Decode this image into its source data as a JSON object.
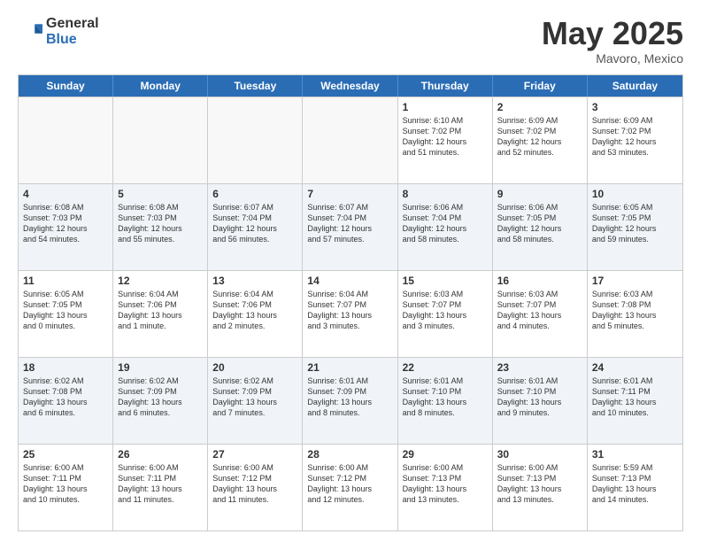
{
  "logo": {
    "general": "General",
    "blue": "Blue"
  },
  "header": {
    "month": "May 2025",
    "location": "Mavoro, Mexico"
  },
  "weekdays": [
    "Sunday",
    "Monday",
    "Tuesday",
    "Wednesday",
    "Thursday",
    "Friday",
    "Saturday"
  ],
  "rows": [
    [
      {
        "day": "",
        "text": "",
        "empty": true
      },
      {
        "day": "",
        "text": "",
        "empty": true
      },
      {
        "day": "",
        "text": "",
        "empty": true
      },
      {
        "day": "",
        "text": "",
        "empty": true
      },
      {
        "day": "1",
        "text": "Sunrise: 6:10 AM\nSunset: 7:02 PM\nDaylight: 12 hours\nand 51 minutes."
      },
      {
        "day": "2",
        "text": "Sunrise: 6:09 AM\nSunset: 7:02 PM\nDaylight: 12 hours\nand 52 minutes."
      },
      {
        "day": "3",
        "text": "Sunrise: 6:09 AM\nSunset: 7:02 PM\nDaylight: 12 hours\nand 53 minutes."
      }
    ],
    [
      {
        "day": "4",
        "text": "Sunrise: 6:08 AM\nSunset: 7:03 PM\nDaylight: 12 hours\nand 54 minutes."
      },
      {
        "day": "5",
        "text": "Sunrise: 6:08 AM\nSunset: 7:03 PM\nDaylight: 12 hours\nand 55 minutes."
      },
      {
        "day": "6",
        "text": "Sunrise: 6:07 AM\nSunset: 7:04 PM\nDaylight: 12 hours\nand 56 minutes."
      },
      {
        "day": "7",
        "text": "Sunrise: 6:07 AM\nSunset: 7:04 PM\nDaylight: 12 hours\nand 57 minutes."
      },
      {
        "day": "8",
        "text": "Sunrise: 6:06 AM\nSunset: 7:04 PM\nDaylight: 12 hours\nand 58 minutes."
      },
      {
        "day": "9",
        "text": "Sunrise: 6:06 AM\nSunset: 7:05 PM\nDaylight: 12 hours\nand 58 minutes."
      },
      {
        "day": "10",
        "text": "Sunrise: 6:05 AM\nSunset: 7:05 PM\nDaylight: 12 hours\nand 59 minutes."
      }
    ],
    [
      {
        "day": "11",
        "text": "Sunrise: 6:05 AM\nSunset: 7:05 PM\nDaylight: 13 hours\nand 0 minutes."
      },
      {
        "day": "12",
        "text": "Sunrise: 6:04 AM\nSunset: 7:06 PM\nDaylight: 13 hours\nand 1 minute."
      },
      {
        "day": "13",
        "text": "Sunrise: 6:04 AM\nSunset: 7:06 PM\nDaylight: 13 hours\nand 2 minutes."
      },
      {
        "day": "14",
        "text": "Sunrise: 6:04 AM\nSunset: 7:07 PM\nDaylight: 13 hours\nand 3 minutes."
      },
      {
        "day": "15",
        "text": "Sunrise: 6:03 AM\nSunset: 7:07 PM\nDaylight: 13 hours\nand 3 minutes."
      },
      {
        "day": "16",
        "text": "Sunrise: 6:03 AM\nSunset: 7:07 PM\nDaylight: 13 hours\nand 4 minutes."
      },
      {
        "day": "17",
        "text": "Sunrise: 6:03 AM\nSunset: 7:08 PM\nDaylight: 13 hours\nand 5 minutes."
      }
    ],
    [
      {
        "day": "18",
        "text": "Sunrise: 6:02 AM\nSunset: 7:08 PM\nDaylight: 13 hours\nand 6 minutes."
      },
      {
        "day": "19",
        "text": "Sunrise: 6:02 AM\nSunset: 7:09 PM\nDaylight: 13 hours\nand 6 minutes."
      },
      {
        "day": "20",
        "text": "Sunrise: 6:02 AM\nSunset: 7:09 PM\nDaylight: 13 hours\nand 7 minutes."
      },
      {
        "day": "21",
        "text": "Sunrise: 6:01 AM\nSunset: 7:09 PM\nDaylight: 13 hours\nand 8 minutes."
      },
      {
        "day": "22",
        "text": "Sunrise: 6:01 AM\nSunset: 7:10 PM\nDaylight: 13 hours\nand 8 minutes."
      },
      {
        "day": "23",
        "text": "Sunrise: 6:01 AM\nSunset: 7:10 PM\nDaylight: 13 hours\nand 9 minutes."
      },
      {
        "day": "24",
        "text": "Sunrise: 6:01 AM\nSunset: 7:11 PM\nDaylight: 13 hours\nand 10 minutes."
      }
    ],
    [
      {
        "day": "25",
        "text": "Sunrise: 6:00 AM\nSunset: 7:11 PM\nDaylight: 13 hours\nand 10 minutes."
      },
      {
        "day": "26",
        "text": "Sunrise: 6:00 AM\nSunset: 7:11 PM\nDaylight: 13 hours\nand 11 minutes."
      },
      {
        "day": "27",
        "text": "Sunrise: 6:00 AM\nSunset: 7:12 PM\nDaylight: 13 hours\nand 11 minutes."
      },
      {
        "day": "28",
        "text": "Sunrise: 6:00 AM\nSunset: 7:12 PM\nDaylight: 13 hours\nand 12 minutes."
      },
      {
        "day": "29",
        "text": "Sunrise: 6:00 AM\nSunset: 7:13 PM\nDaylight: 13 hours\nand 13 minutes."
      },
      {
        "day": "30",
        "text": "Sunrise: 6:00 AM\nSunset: 7:13 PM\nDaylight: 13 hours\nand 13 minutes."
      },
      {
        "day": "31",
        "text": "Sunrise: 5:59 AM\nSunset: 7:13 PM\nDaylight: 13 hours\nand 14 minutes."
      }
    ]
  ]
}
